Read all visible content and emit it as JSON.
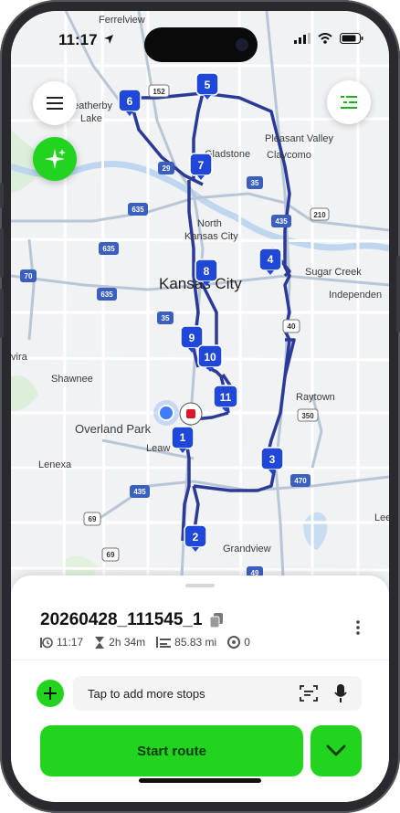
{
  "status_bar": {
    "time": "11:17"
  },
  "map": {
    "labels": {
      "ferrelview": "Ferrelview",
      "weatherby_lake": "Weatherby",
      "weatherby_lake2": "Lake",
      "gladstone": "Gladstone",
      "pleasant_valley": "Pleasant Valley",
      "claycomo": "Claycomo",
      "north_kc": "North",
      "north_kc2": "Kansas City",
      "kansas_city": "Kansas City",
      "sugar_creek": "Sugar Creek",
      "independence": "Independen",
      "shawnee": "Shawnee",
      "raytown": "Raytown",
      "overland_park": "Overland Park",
      "leawood": "Leaw",
      "lenexa": "Lenexa",
      "grandview": "Grandview",
      "olathe_edge": "vira",
      "lees": "Lee"
    },
    "shields": [
      "152",
      "29",
      "35",
      "635",
      "210",
      "435",
      "635",
      "70",
      "635",
      "35",
      "40",
      "350",
      "435",
      "470",
      "69",
      "69",
      "49"
    ],
    "stops": [
      "1",
      "2",
      "3",
      "4",
      "5",
      "6",
      "7",
      "8",
      "9",
      "10",
      "11"
    ]
  },
  "route": {
    "title": "20260428_111545_1",
    "start_time": "11:17",
    "duration": "2h 34m",
    "distance": "85.83 mi",
    "skipped": "0"
  },
  "add_stops": {
    "placeholder": "Tap to add more stops"
  },
  "actions": {
    "start_label": "Start route"
  },
  "colors": {
    "accent": "#22d41f",
    "route": "#2b3a98",
    "pin": "#1f47d8"
  },
  "icons": [
    "menu-icon",
    "sparkle-icon",
    "list-icon",
    "copy-icon",
    "clock-icon",
    "hourglass-icon",
    "distance-icon",
    "skip-icon",
    "more-icon",
    "plus-icon",
    "scan-icon",
    "mic-icon",
    "chevron-down-icon"
  ]
}
